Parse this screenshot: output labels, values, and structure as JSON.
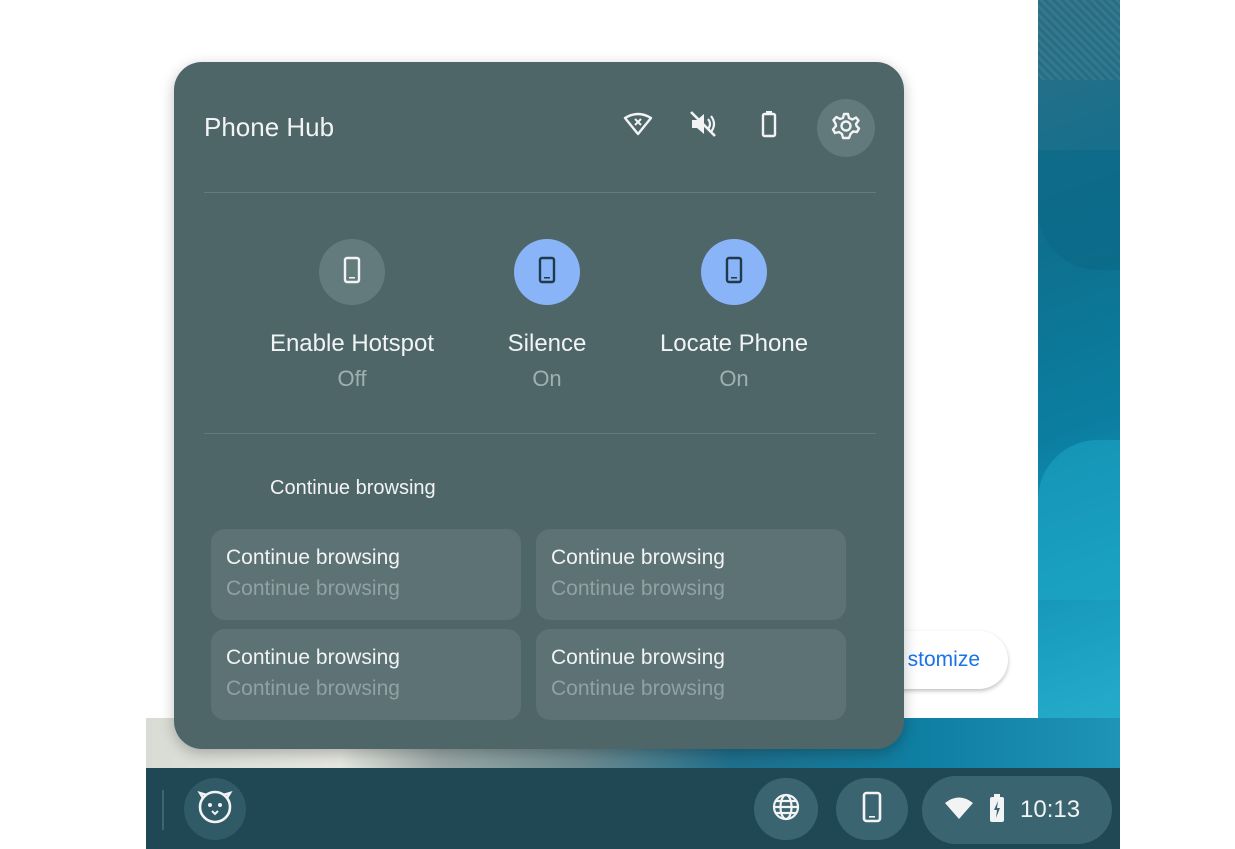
{
  "panel": {
    "title": "Phone Hub",
    "header_icons": [
      "wifi-off-icon",
      "volume-off-icon",
      "battery-icon",
      "gear-icon"
    ]
  },
  "quick_tiles": [
    {
      "label": "Enable Hotspot",
      "state": "Off",
      "icon": "phone-icon"
    },
    {
      "label": "Silence",
      "state": "On",
      "icon": "phone-icon"
    },
    {
      "label": "Locate Phone",
      "state": "On",
      "icon": "phone-icon"
    }
  ],
  "browsing": {
    "section_title": "Continue browsing",
    "cards": [
      {
        "title": "Continue browsing",
        "subtitle": "Continue browsing"
      },
      {
        "title": "Continue browsing",
        "subtitle": "Continue browsing"
      },
      {
        "title": "Continue browsing",
        "subtitle": "Continue browsing"
      },
      {
        "title": "Continue browsing",
        "subtitle": "Continue browsing"
      }
    ]
  },
  "background": {
    "customize_label": "stomize"
  },
  "shelf": {
    "icons": [
      "launcher-icon",
      "globe-icon",
      "phone-icon",
      "wifi-icon",
      "battery-charging-icon"
    ],
    "time": "10:13"
  },
  "colors": {
    "panel_bg": "#4f6669",
    "tile_on": "#8ab4f8",
    "tile_off": "#647b7d",
    "shelf_bg": "#1f4854",
    "accent_link": "#1a73e8"
  }
}
